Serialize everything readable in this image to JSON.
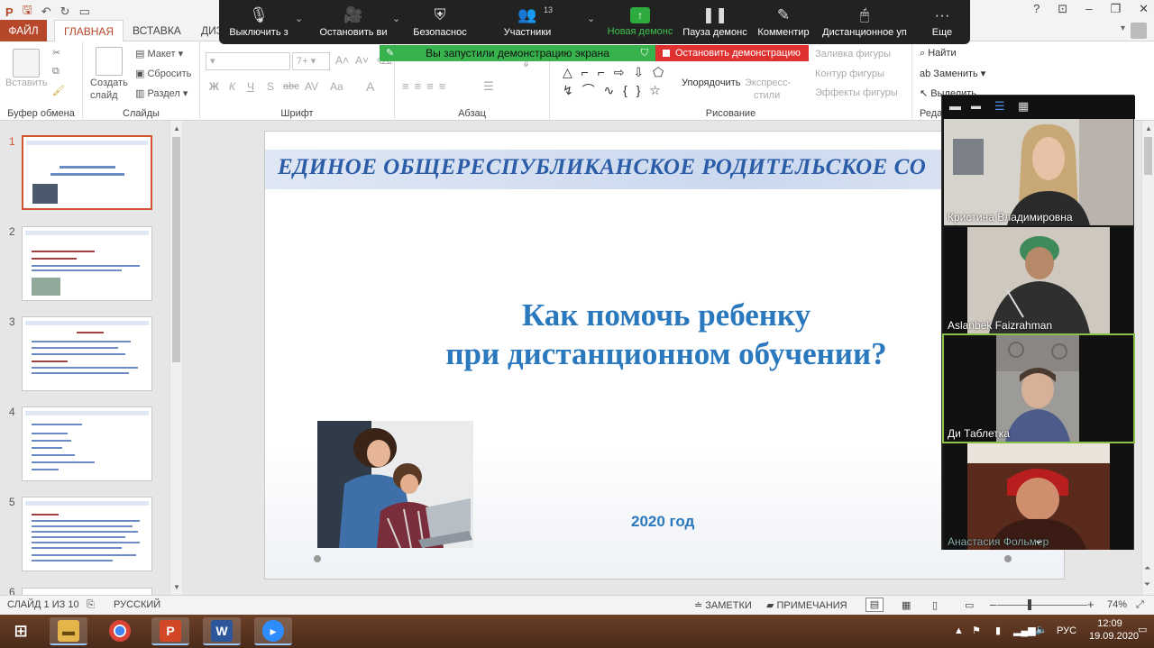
{
  "titlebar": {
    "help": "?",
    "min": "–",
    "max": "❐",
    "close": "✕"
  },
  "tabs": {
    "file": "ФАЙЛ",
    "home": "ГЛАВНАЯ",
    "insert": "ВСТАВКА",
    "design": "ДИЗ"
  },
  "ribbon": {
    "paste": "Вставить",
    "clipboard": "Буфер обмена",
    "new_slide_1": "Создать",
    "new_slide_2": "слайд",
    "layout": "Макет",
    "reset": "Сбросить",
    "section": "Раздел",
    "slides": "Слайды",
    "font_size": "7+",
    "font": "Шрифт",
    "bold": "Ж",
    "italic": "К",
    "underline": "Ч",
    "strike": "S",
    "abc": "abc",
    "av": "AV",
    "aa": "Aa",
    "font_color": "A",
    "paragraph": "Абзац",
    "arrange": "Упорядочить",
    "quick_styles_1": "Экспресс-",
    "quick_styles_2": "стили",
    "shape_fill": "Заливка фигуры",
    "shape_outline": "Контур фигуры",
    "shape_effects": "Эффекты фигуры",
    "drawing": "Рисование",
    "find": "Найти",
    "replace": "Заменить",
    "select": "Выделить",
    "editing": "Реда"
  },
  "zoom": {
    "mute": "Выключить з",
    "stop_video": "Остановить ви",
    "security": "Безопаснос",
    "participants": "Участники",
    "participants_count": "13",
    "new_share": "Новая демонс",
    "pause_share": "Пауза демонс",
    "annotate": "Комментир",
    "remote": "Дистанционное уп",
    "more": "Еще",
    "share_banner": "Вы запустили демонстрацию экрана",
    "stop_banner": "Остановить демонстрацию"
  },
  "thumbs": {
    "n1": "1",
    "n2": "2",
    "n3": "3",
    "n4": "4",
    "n5": "5",
    "n6": "6"
  },
  "slide": {
    "header": "ЕДИНОЕ ОБЩЕРЕСПУБЛИКАНСКОЕ РОДИТЕЛЬСКОЕ СО",
    "title_line1": "Как помочь ребенку",
    "title_line2": "при дистанционном обучении?",
    "year": "2020 год"
  },
  "gallery": {
    "p1": "Кристина Владимировна",
    "p2": "Aslanbek Faizrahman",
    "p3": "Ди Таблетка",
    "p4": "Анастасия Фольмер"
  },
  "status": {
    "slide": "СЛАЙД 1 ИЗ 10",
    "lang": "РУССКИЙ",
    "notes": "ЗАМЕТКИ",
    "comments": "ПРИМЕЧАНИЯ",
    "zoom": "74%"
  },
  "taskbar": {
    "lang": "РУС",
    "time": "12:09",
    "date": "19.09.2020"
  },
  "colors": {
    "accent": "#b7472a",
    "slide_blue": "#2a78bd",
    "zoom_green": "#37b24d",
    "zoom_red": "#e03131"
  }
}
